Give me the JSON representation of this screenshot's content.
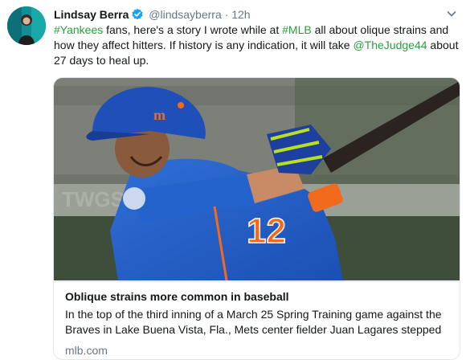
{
  "tweet": {
    "author_name": "Lindsay Berra",
    "handle": "@lindsayberra",
    "separator": "·",
    "timestamp": "12h",
    "text_parts": {
      "hashtag1": "#Yankees",
      "part1": " fans, here's a story I wrote while at ",
      "hashtag2": "#MLB",
      "part2": " all about olique strains and how they affect hitters. If history is any indication, it will take ",
      "mention": "@TheJudge44",
      "part3": " about 27 days to heal up."
    },
    "link_color": "#2a9d3e"
  },
  "card": {
    "title": "Oblique strains more common in baseball",
    "description": "In the top of the third inning of a March 25 Spring Training game against the Braves in Lake Buena Vista, Fla., Mets center fielder Juan Lagares stepped",
    "domain": "mlb.com",
    "jersey_number": "12",
    "image_alt": "Mets player swinging a bat in a blue helmet and jersey"
  },
  "icons": {
    "verified": "verified-badge-icon",
    "caret": "chevron-down-icon"
  }
}
